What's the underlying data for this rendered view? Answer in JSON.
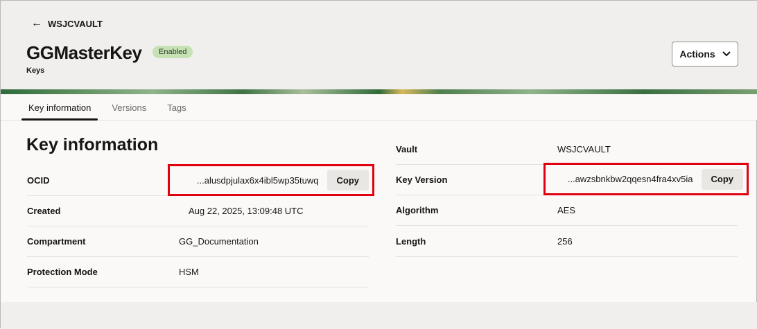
{
  "header": {
    "back_label": "WSJCVAULT",
    "title": "GGMasterKey",
    "status": "Enabled",
    "subtitle": "Keys",
    "actions_label": "Actions"
  },
  "tabs": [
    {
      "label": "Key information"
    },
    {
      "label": "Versions"
    },
    {
      "label": "Tags"
    }
  ],
  "section_title": "Key information",
  "left": [
    {
      "label": "OCID",
      "value": "...alusdpjulax6x4ibl5wp35tuwq"
    },
    {
      "label": "Created",
      "value": "Aug 22, 2025, 13:09:48 UTC"
    },
    {
      "label": "Compartment",
      "value": "GG_Documentation"
    },
    {
      "label": "Protection Mode",
      "value": "HSM"
    }
  ],
  "right": [
    {
      "label": "Vault",
      "value": "WSJCVAULT"
    },
    {
      "label": "Key Version",
      "value": "...awzsbnkbw2qqesn4fra4xv5ia"
    },
    {
      "label": "Algorithm",
      "value": "AES"
    },
    {
      "label": "Length",
      "value": "256"
    }
  ],
  "copy_label": "Copy"
}
